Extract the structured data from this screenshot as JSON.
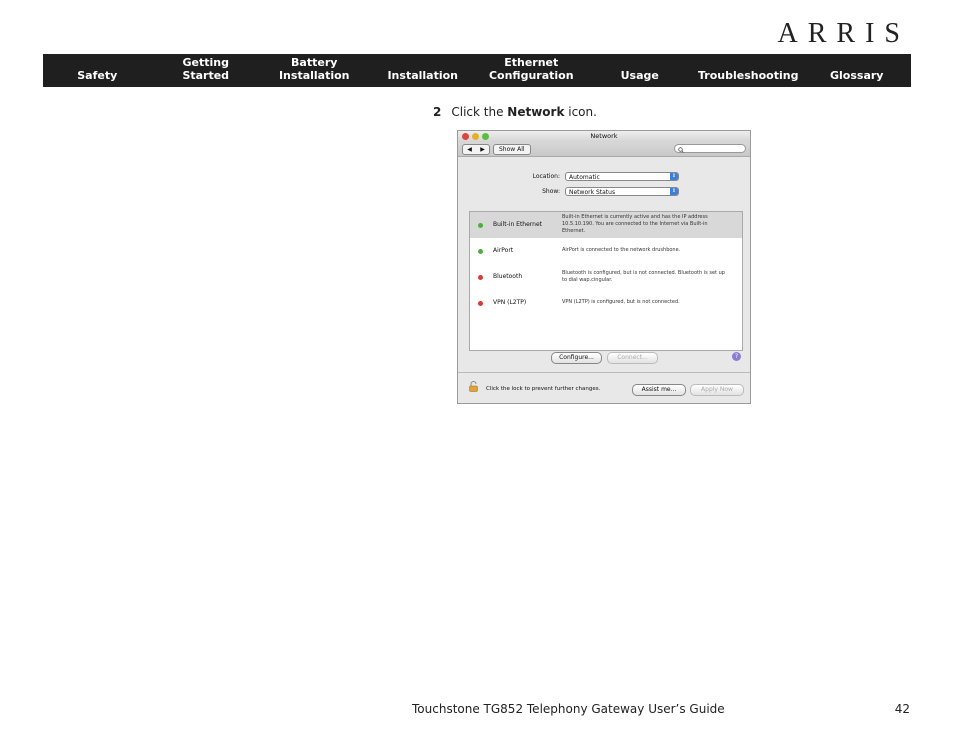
{
  "brand": {
    "logo_text": "ARRIS"
  },
  "nav": [
    {
      "label": "Safety"
    },
    {
      "label": "Getting\nStarted"
    },
    {
      "label": "Battery\nInstallation"
    },
    {
      "label": "Installation"
    },
    {
      "label": "Ethernet\nConfiguration"
    },
    {
      "label": "Usage"
    },
    {
      "label": "Troubleshooting"
    },
    {
      "label": "Glossary"
    }
  ],
  "step": {
    "number": "2",
    "text_before": "Click the ",
    "bold": "Network",
    "text_after": " icon."
  },
  "window": {
    "title": "Network",
    "nav_back": "◀",
    "nav_fwd": "▶",
    "show_all": "Show All",
    "search_icon": "magnifier-icon",
    "location_label": "Location:",
    "location_value": "Automatic",
    "show_label": "Show:",
    "show_value": "Network Status",
    "services": [
      {
        "name": "Built-in Ethernet",
        "status": "green",
        "desc": "Built-in Ethernet is currently active and has the IP address 10.5.10.190. You are connected to the Internet via Built-in Ethernet."
      },
      {
        "name": "AirPort",
        "status": "green",
        "desc": "AirPort is connected to the network drushbone."
      },
      {
        "name": "Bluetooth",
        "status": "red",
        "desc": "Bluetooth is configured, but is not connected. Bluetooth is set up to dial wap.cingular."
      },
      {
        "name": "VPN (L2TP)",
        "status": "red",
        "desc": "VPN (L2TP) is configured, but is not connected."
      }
    ],
    "configure_label": "Configure...",
    "connect_label": "Connect...",
    "help_label": "?",
    "lock_text": "Click the lock to prevent further changes.",
    "assist_label": "Assist me...",
    "apply_label": "Apply Now"
  },
  "colors": {
    "nav_bg": "#1f1f1f",
    "status_green": "#4caf3d",
    "status_red": "#d93a32"
  },
  "footer": {
    "title": "Touchstone TG852 Telephony Gateway User’s Guide",
    "page": "42"
  }
}
